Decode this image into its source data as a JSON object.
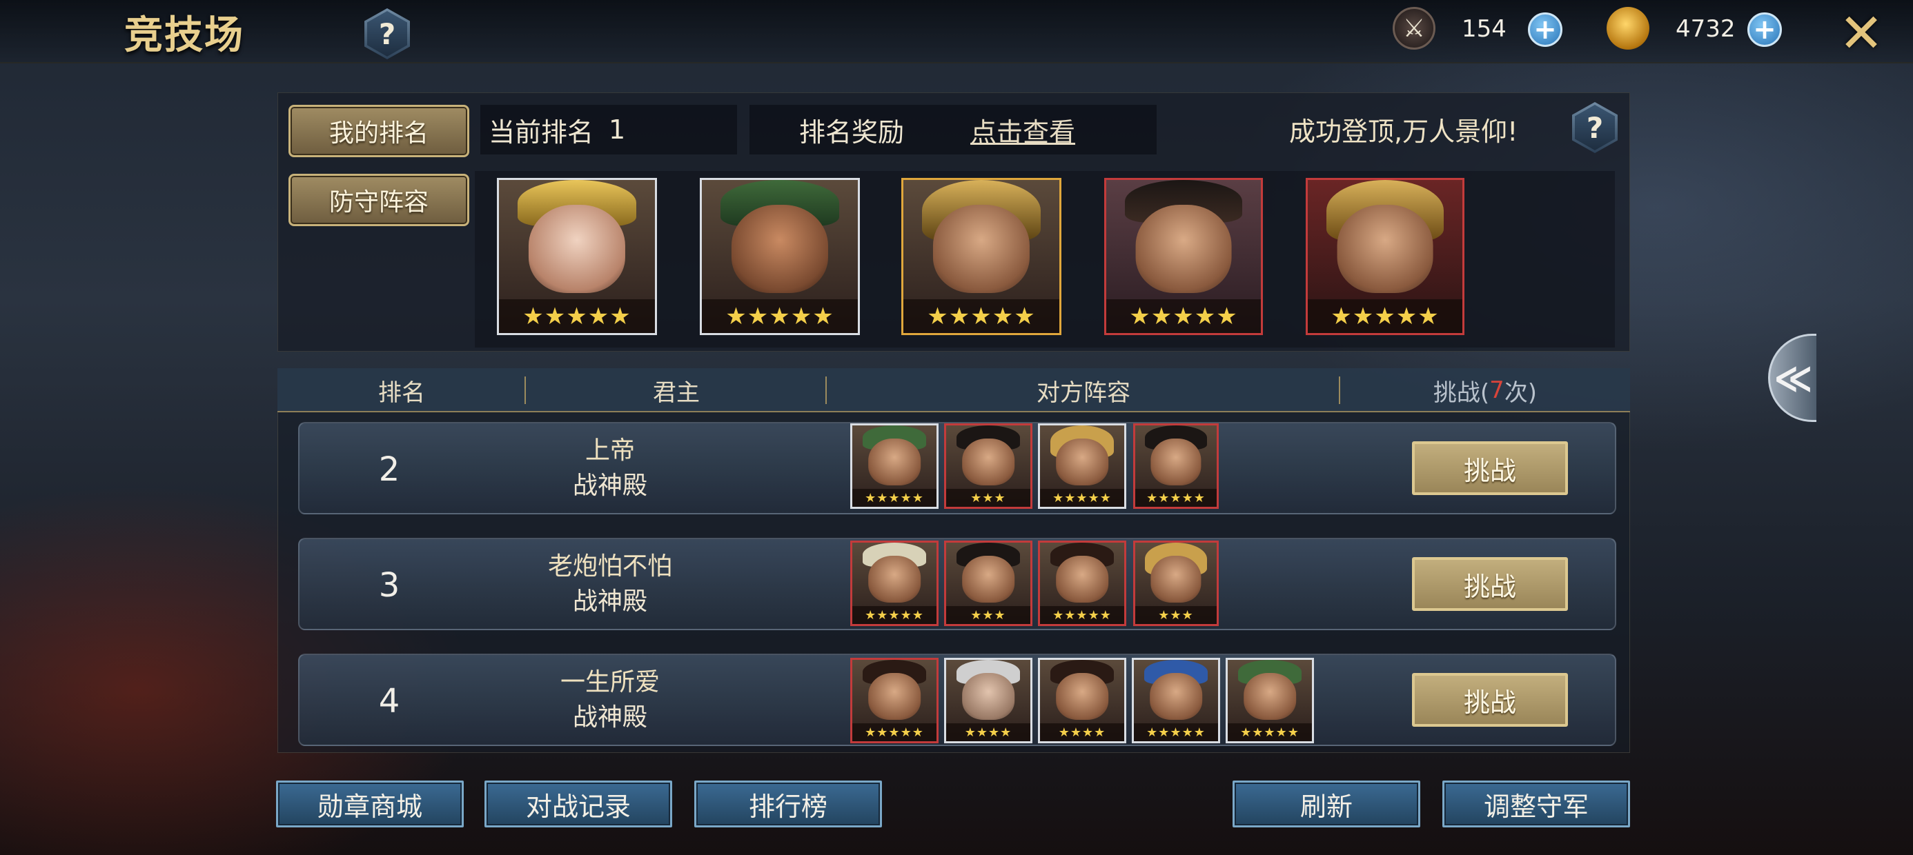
{
  "header": {
    "title": "竞技场",
    "help_symbol": "?",
    "resources": [
      {
        "icon": "crossed-swords-token-icon",
        "value": "154",
        "add_symbol": "+"
      },
      {
        "icon": "gold-ingot-icon",
        "value": "4732",
        "add_symbol": "+"
      }
    ],
    "close_symbol": "✕"
  },
  "my_info": {
    "my_rank_button": "我的排名",
    "current_rank_label": "当前排名",
    "current_rank_value": "1",
    "reward_label": "排名奖励",
    "reward_link": "点击查看",
    "motto": "成功登顶,万人景仰!",
    "help_symbol": "?",
    "defense_button": "防守阵容",
    "defense_heroes": [
      {
        "name": "female-gold-crown",
        "stars": 5
      },
      {
        "name": "green-headscarf-bearded",
        "stars": 5
      },
      {
        "name": "gold-horned-helmet",
        "stars": 5
      },
      {
        "name": "mustached-scholar",
        "stars": 5
      },
      {
        "name": "gold-helmet-warrior",
        "stars": 5
      }
    ]
  },
  "table": {
    "headers": {
      "rank": "排名",
      "lord": "君主",
      "lineup": "对方阵容",
      "challenge_prefix": "挑战(",
      "challenge_count": "7",
      "challenge_suffix": "次)"
    },
    "rows": [
      {
        "rank": "2",
        "name": "上帝",
        "server": "战神殿",
        "button": "挑战",
        "heroes": [
          {
            "stars": 5
          },
          {
            "stars": 3
          },
          {
            "stars": 5
          },
          {
            "stars": 5
          }
        ]
      },
      {
        "rank": "3",
        "name": "老炮怕不怕",
        "server": "战神殿",
        "button": "挑战",
        "heroes": [
          {
            "stars": 5
          },
          {
            "stars": 3
          },
          {
            "stars": 5
          },
          {
            "stars": 3
          }
        ]
      },
      {
        "rank": "4",
        "name": "一生所爱",
        "server": "战神殿",
        "button": "挑战",
        "heroes": [
          {
            "stars": 5
          },
          {
            "stars": 4
          },
          {
            "stars": 4
          },
          {
            "stars": 5
          },
          {
            "stars": 5
          }
        ]
      }
    ]
  },
  "footer": {
    "left_buttons": [
      "勋章商城",
      "对战记录",
      "排行榜"
    ],
    "right_buttons": [
      "刷新",
      "调整守军"
    ]
  },
  "side_tab": {
    "symbol": "≪"
  },
  "colors": {
    "gold_title": "#e8cf8e",
    "challenge_count": "#d9443a",
    "accent_blue": "#3b6a93"
  }
}
